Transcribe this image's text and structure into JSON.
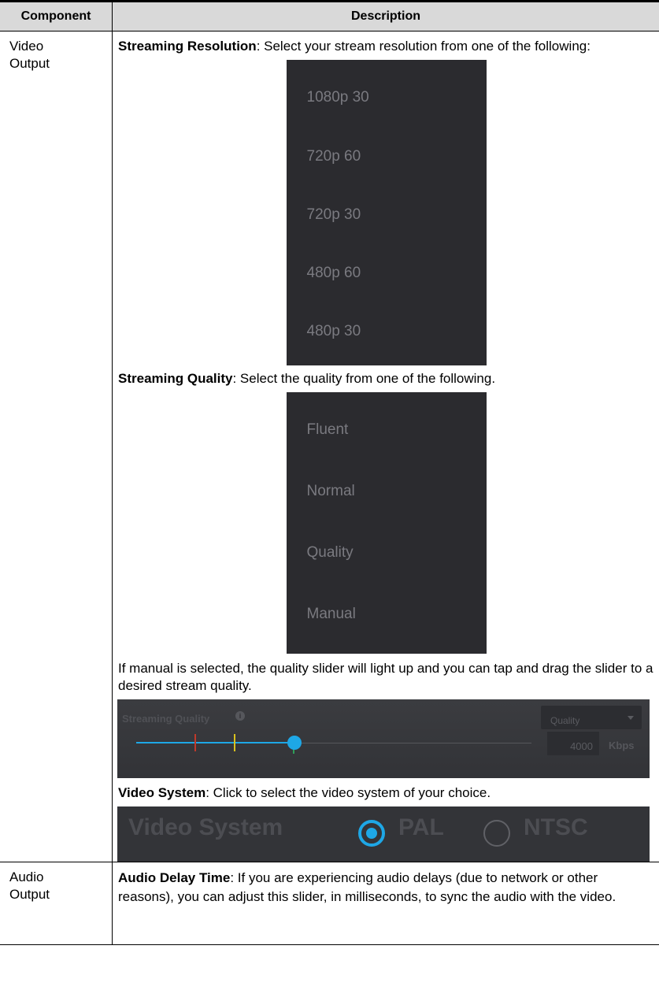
{
  "table": {
    "headers": [
      "Component",
      "Description"
    ],
    "rows": [
      {
        "component": [
          "Video",
          "Output"
        ],
        "streaming_resolution": {
          "title": "Streaming Resolution",
          "text": ": Select your stream resolution from one of the following:",
          "options": [
            "1080p 30",
            "720p 60",
            "720p 30",
            "480p 60",
            "480p 30"
          ]
        },
        "streaming_quality": {
          "title": "Streaming Quality",
          "text": ": Select the quality from one of the following.",
          "options": [
            "Fluent",
            "Normal",
            "Quality",
            "Manual"
          ]
        },
        "manual_note": "If manual is selected, the quality slider will light up and you can tap and drag the slider to a desired stream quality.",
        "slider_panel": {
          "title": "Streaming Quality",
          "info_icon": "i",
          "dropdown_value": "Quality",
          "bitrate_value": "4000",
          "bitrate_unit": "Kbps",
          "slider_level": 0.4
        },
        "video_system": {
          "title": "Video System",
          "text": ": Click to select the video system of your choice.",
          "panel_label": "Video System",
          "options": [
            "PAL",
            "NTSC"
          ],
          "selected": "PAL"
        }
      },
      {
        "component": [
          "Audio",
          "Output"
        ],
        "audio_delay": {
          "title": "Audio Delay Time",
          "text": ": If you are experiencing audio delays (due to network or other reasons), you can adjust this slider, in milliseconds, to sync the audio with the video."
        }
      }
    ]
  },
  "colors": {
    "accent": "#1ea7e6",
    "panel_bg": "#2b2b2f",
    "header_bg": "#d9d9d9"
  }
}
